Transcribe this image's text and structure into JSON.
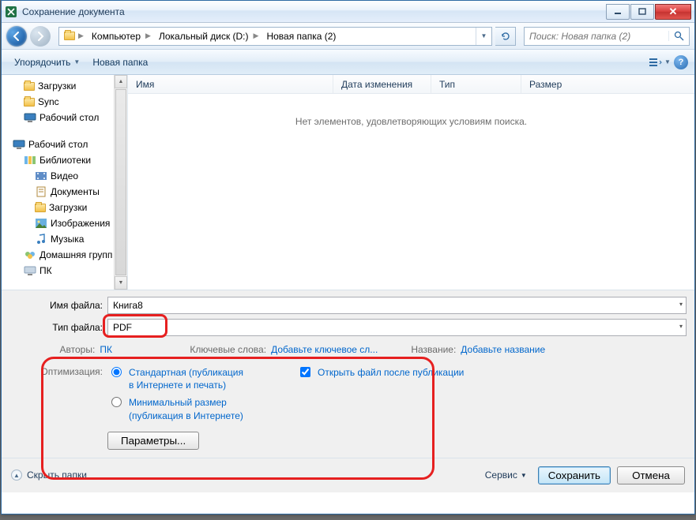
{
  "titlebar": {
    "title": "Сохранение документа"
  },
  "breadcrumb": {
    "computer": "Компьютер",
    "disk": "Локальный диск (D:)",
    "folder": "Новая папка (2)"
  },
  "search": {
    "placeholder": "Поиск: Новая папка (2)"
  },
  "toolbar": {
    "organize": "Упорядочить",
    "newfolder": "Новая папка"
  },
  "columns": {
    "name": "Имя",
    "date": "Дата изменения",
    "type": "Тип",
    "size": "Размер"
  },
  "empty": "Нет элементов, удовлетворяющих условиям поиска.",
  "tree": {
    "downloads": "Загрузки",
    "sync": "Sync",
    "desktop_fav": "Рабочий стол",
    "desktop": "Рабочий стол",
    "libraries": "Библиотеки",
    "video": "Видео",
    "documents": "Документы",
    "downloads2": "Загрузки",
    "pictures": "Изображения",
    "music": "Музыка",
    "homegroup": "Домашняя групп",
    "pc": "ПК"
  },
  "filename": {
    "label": "Имя файла:",
    "value": "Книга8"
  },
  "filetype": {
    "label": "Тип файла:",
    "value": "PDF"
  },
  "meta": {
    "authors_lbl": "Авторы:",
    "authors_val": "ПК",
    "keywords_lbl": "Ключевые слова:",
    "keywords_val": "Добавьте ключевое сл...",
    "title_lbl": "Название:",
    "title_val": "Добавьте название"
  },
  "opt": {
    "label": "Оптимизация:",
    "standard": "Стандартная (публикация в Интернете и печать)",
    "minimal": "Минимальный размер (публикация в Интернете)",
    "openafter": "Открыть файл после публикации",
    "params": "Параметры..."
  },
  "footer": {
    "hide": "Скрыть папки",
    "service": "Сервис",
    "save": "Сохранить",
    "cancel": "Отмена"
  }
}
